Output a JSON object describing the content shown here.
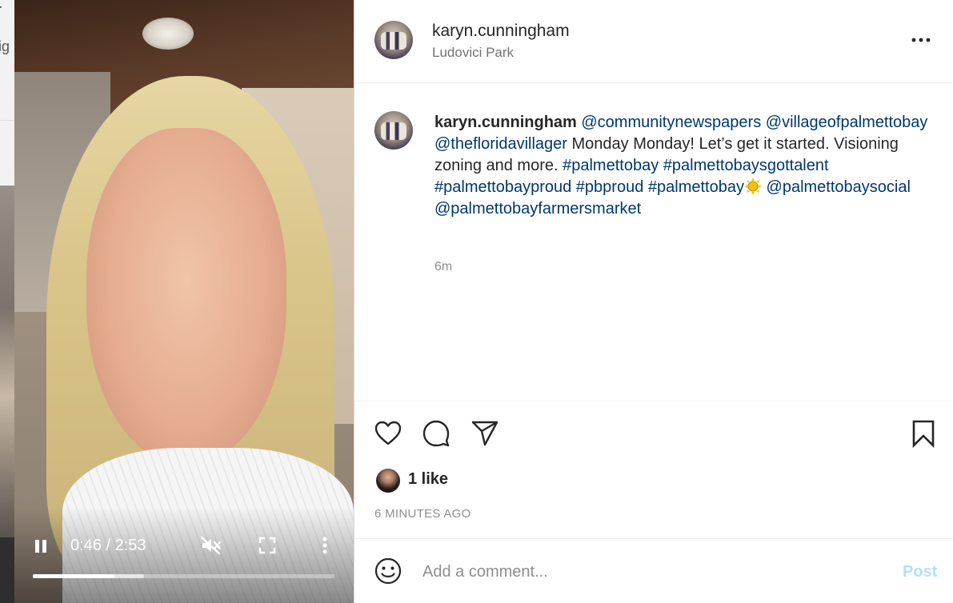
{
  "background_page": {
    "text_fragment_1": "r",
    "text_fragment_2": "ig"
  },
  "video": {
    "time_display": "0:46 / 2:53",
    "played_fraction": 0.27,
    "buffered_fraction": 0.37,
    "controls": {
      "pause_icon": "pause-icon",
      "mute_icon": "volume-muted-icon",
      "fullscreen_icon": "fullscreen-icon",
      "more_icon": "more-vertical-icon"
    }
  },
  "header": {
    "username": "karyn.cunningham",
    "location": "Ludovici Park",
    "more_icon": "more-horizontal-icon"
  },
  "caption": {
    "username": "karyn.cunningham",
    "segments": [
      {
        "type": "tag",
        "text": "@communitynewspapers"
      },
      {
        "type": "tag",
        "text": "@villageofpalmettobay"
      },
      {
        "type": "tag",
        "text": "@thefloridavillager"
      },
      {
        "type": "text",
        "text": "Monday Monday! Let’s get it started. Visioning zoning and more."
      },
      {
        "type": "tag",
        "text": "#palmettobay"
      },
      {
        "type": "tag",
        "text": "#palmettobaysgottalent"
      },
      {
        "type": "tag",
        "text": "#palmettobayproud"
      },
      {
        "type": "tag",
        "text": "#pbproud"
      },
      {
        "type": "tag",
        "text": "#palmettobay"
      },
      {
        "type": "tag",
        "text": "@palmettobaysocial"
      },
      {
        "type": "tag",
        "text": "@palmettobayfarmersmarket"
      }
    ],
    "time": "6m"
  },
  "actions": {
    "like_icon": "heart-icon",
    "comment_icon": "comment-icon",
    "share_icon": "share-icon",
    "save_icon": "bookmark-icon"
  },
  "likes": {
    "count_text": "1 like",
    "posted_ago": "6 MINUTES AGO"
  },
  "comment_box": {
    "placeholder": "Add a comment...",
    "value": "",
    "post_label": "Post"
  },
  "colors": {
    "link": "#00376b",
    "text": "#262626",
    "muted": "#8e8e8e",
    "post_disabled": "#b2dffc",
    "divider": "#efefef"
  }
}
